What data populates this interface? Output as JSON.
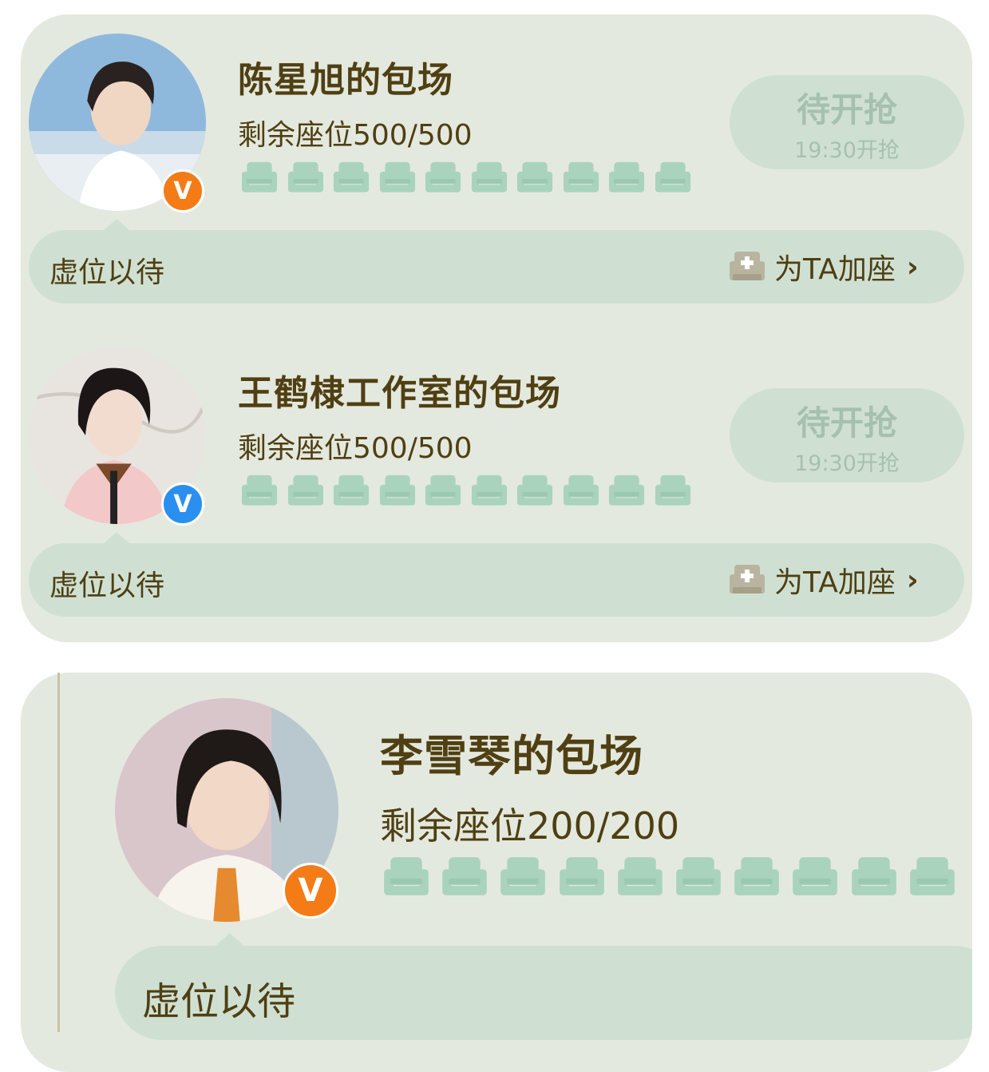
{
  "colors": {
    "card_bg": "#e4e9df",
    "bar_bg": "#cfe0d3",
    "seat": "#a9d3bd",
    "text": "#4f3f12",
    "badge_orange": "#f47b16",
    "badge_blue": "#2b8ff0"
  },
  "sessions": [
    {
      "title": "陈星旭的包场",
      "seats_label": "剩余座位500/500",
      "badge": "V",
      "badge_color": "orange",
      "grab_label": "待开抢",
      "grab_time": "19:30开抢",
      "wait_label": "虚位以待",
      "add_seat_label": "为TA加座",
      "chevron": "›"
    },
    {
      "title": "王鹤棣工作室的包场",
      "seats_label": "剩余座位500/500",
      "badge": "V",
      "badge_color": "blue",
      "grab_label": "待开抢",
      "grab_time": "19:30开抢",
      "wait_label": "虚位以待",
      "add_seat_label": "为TA加座",
      "chevron": "›"
    },
    {
      "title": "李雪琴的包场",
      "seats_label": "剩余座位200/200",
      "badge": "V",
      "badge_color": "orange",
      "wait_label": "虚位以待"
    }
  ]
}
